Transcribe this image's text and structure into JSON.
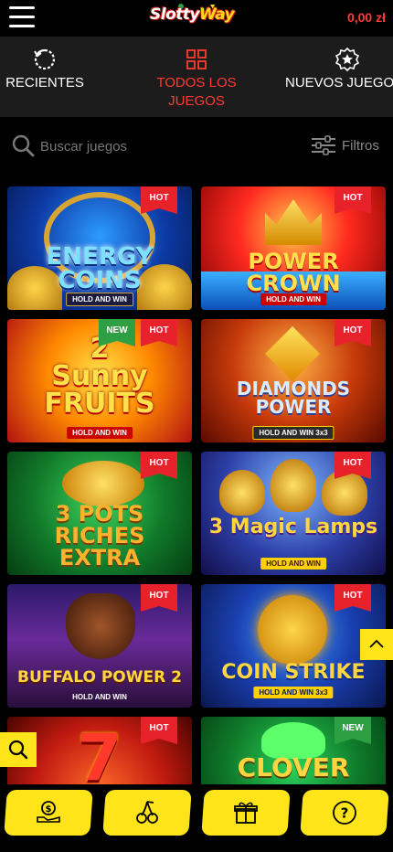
{
  "header": {
    "logo": {
      "part1": "Slotty",
      "part2": "Way"
    },
    "balance": "0,00 zł"
  },
  "tabs": [
    {
      "label": "RECIENTES",
      "icon": "refresh-icon"
    },
    {
      "label": "TODOS LOS JUEGOS",
      "icon": "grid-icon",
      "active": true
    },
    {
      "label": "NUEVOS JUEGOS",
      "icon": "badge-star-icon"
    }
  ],
  "search": {
    "placeholder": "Buscar juegos"
  },
  "filters": {
    "label": "Filtros"
  },
  "games": [
    {
      "title": "ENERGY COINS",
      "subtitle": "HOLD AND WIN",
      "badges": [
        "HOT"
      ]
    },
    {
      "title": "POWER CROWN",
      "subtitle": "HOLD AND WIN",
      "badges": [
        "HOT"
      ]
    },
    {
      "title": "2 Sunny FRUITS",
      "subtitle": "HOLD AND WIN",
      "badges": [
        "NEW",
        "HOT"
      ]
    },
    {
      "title": "DIAMONDS POWER",
      "subtitle": "HOLD AND WIN 3x3",
      "badges": [
        "HOT"
      ]
    },
    {
      "title": "3 POTS RICHES EXTRA",
      "subtitle": "",
      "badges": [
        "HOT"
      ]
    },
    {
      "title": "3 Magic Lamps",
      "subtitle": "HOLD AND WIN",
      "badges": [
        "HOT"
      ]
    },
    {
      "title": "BUFFALO POWER 2",
      "subtitle": "HOLD AND WIN",
      "badges": [
        "HOT"
      ]
    },
    {
      "title": "COIN STRIKE",
      "subtitle": "HOLD AND WIN 3x3",
      "badges": [
        "HOT"
      ]
    },
    {
      "title": "7",
      "subtitle": "",
      "badges": [
        "HOT"
      ]
    },
    {
      "title": "CLOVER",
      "subtitle": "",
      "badges": [
        "NEW"
      ]
    }
  ],
  "bottom_nav": [
    {
      "icon": "cash-icon"
    },
    {
      "icon": "cherries-icon"
    },
    {
      "icon": "gift-icon"
    },
    {
      "icon": "help-icon"
    }
  ],
  "colors": {
    "accent": "#ffe419",
    "active": "#ff3b30",
    "hot": "#e8222a",
    "new": "#2ea043"
  }
}
